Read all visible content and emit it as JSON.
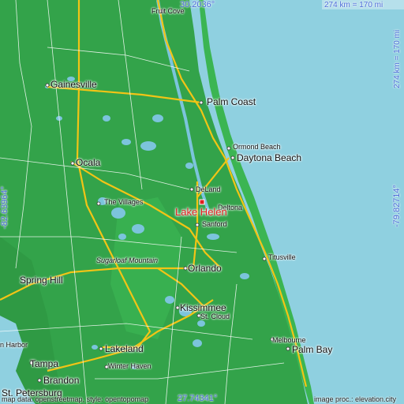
{
  "map": {
    "coords": {
      "top": "30.2036°",
      "bottom": "27.74341°",
      "left": "-82.63964°",
      "right": "-79.82714°"
    },
    "scale": {
      "top": "274 km = 170 mi",
      "right": "274 km = 170 mi"
    },
    "focus_city": "Lake Helen",
    "cities": {
      "fruit_cove": "Fruit Cove",
      "gainesville": "Gainesville",
      "palm_coast": "Palm Coast",
      "ormond_beach": "Ormond Beach",
      "daytona_beach": "Daytona Beach",
      "ocala": "Ocala",
      "deland": "DeLand",
      "the_villages": "The Villages",
      "deltona": "Deltona",
      "sanford": "Sanford",
      "sugarloaf": "Sugarloaf Mountain",
      "titusville": "Titusville",
      "orlando": "Orlando",
      "spring_hill": "Spring Hill",
      "kissimmee": "Kissimmee",
      "st_cloud": "St. Cloud",
      "melbourne": "Melbourne",
      "palm_bay": "Palm Bay",
      "lakeland": "Lakeland",
      "town_n_country": "n Harbor",
      "winter_haven": "Winter Haven",
      "tampa": "Tampa",
      "brandon": "Brandon",
      "st_petersburg": "St. Petersburg"
    },
    "credits": {
      "left": "map data: openstreetmap, style: opentopomap",
      "right": "image proc.: elevation.city"
    },
    "colors": {
      "land": "#33a34a",
      "land_light": "#3bb552",
      "ocean": "#8fd0e0",
      "lake": "#7cc4dc",
      "highway": "#f2c416",
      "major_road": "#ffffff",
      "focus_marker": "#e02020",
      "coord_text": "#4a6bd8"
    }
  }
}
